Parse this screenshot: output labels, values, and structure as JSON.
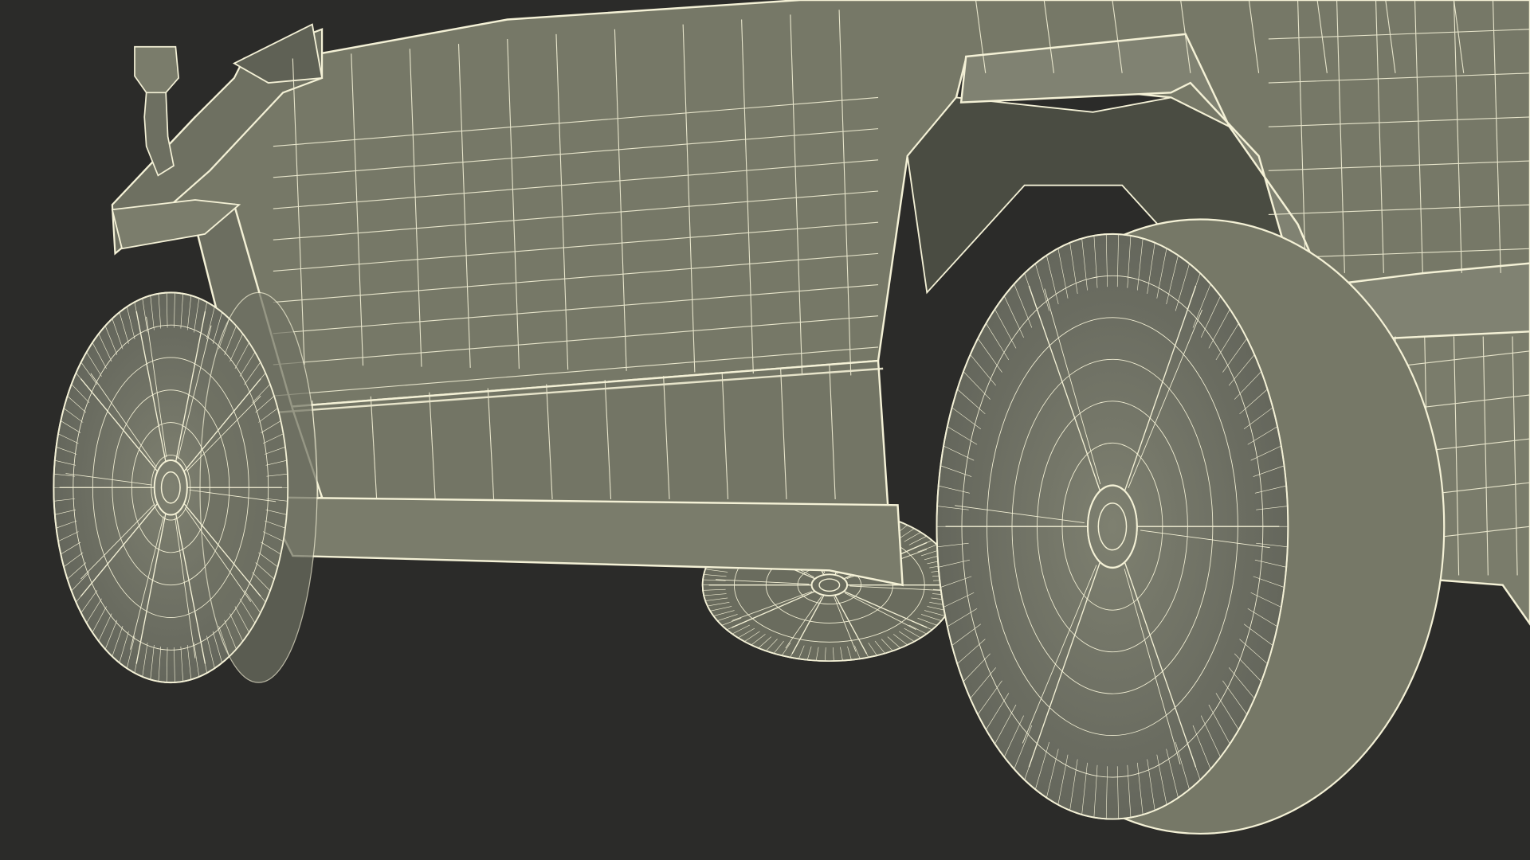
{
  "scene": {
    "description_visible_text": "",
    "background_color": "#2b2b29",
    "body_color": "#767867",
    "body_shadow_color": "#5a5c4e",
    "wire_color": "#f4f1d6"
  }
}
